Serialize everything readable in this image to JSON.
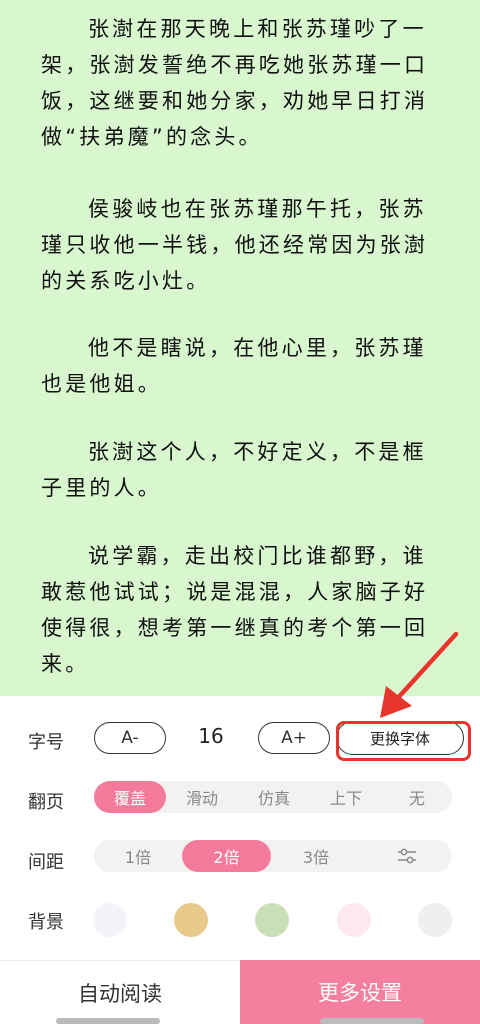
{
  "reader": {
    "background": "#d9f7cf",
    "paragraphs": [
      "张澍在那天晚上和张苏瑾吵了一架，张澍发誓绝不再吃她张苏瑾一口饭，这继要和她分家，劝她早日打消做“扶弟魔”的念头。",
      "侯骏岐也在张苏瑾那午托，张苏瑾只收他一半钱，他还经常因为张澍的关系吃小灶。",
      "他不是瞎说，在他心里，张苏瑾也是他姐。",
      "张澍这个人，不好定义，不是框子里的人。",
      "说学霸，走出校门比谁都野，谁敢惹他试试；说是混混，人家脑子好使得很，想考第一继真的考个第一回来。"
    ]
  },
  "settings": {
    "font_size": {
      "label": "字号",
      "decrease": "A-",
      "value": "16",
      "increase": "A+",
      "change_font": "更换字体"
    },
    "page_turn": {
      "label": "翻页",
      "options": [
        "覆盖",
        "滑动",
        "仿真",
        "上下",
        "无"
      ],
      "selected": "覆盖"
    },
    "spacing": {
      "label": "间距",
      "options": [
        "1倍",
        "2倍",
        "3倍"
      ],
      "selected": "2倍",
      "custom_icon": "sliders-icon"
    },
    "background": {
      "label": "背景",
      "colors": [
        "#f4f4f8",
        "#e8c98c",
        "#c9dfb8",
        "#fde9ee",
        "#efefef"
      ]
    }
  },
  "bottom": {
    "auto_read": "自动阅读",
    "more_settings": "更多设置"
  },
  "colors": {
    "accent": "#f47a9b",
    "annotation": "#e8352c"
  }
}
